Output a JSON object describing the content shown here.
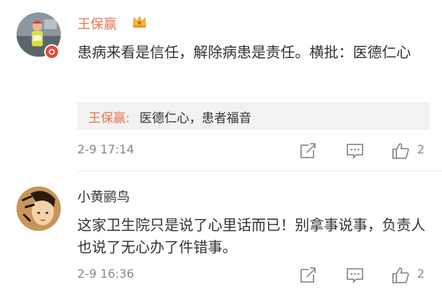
{
  "comments": [
    {
      "username": "王保赢",
      "text": "患病来看是信任，解除病患是责任。横批：医德仁心",
      "reply": {
        "username": "王保赢:",
        "text": "医德仁心，患者福音"
      },
      "time": "2-9 17:14",
      "likes": "2"
    },
    {
      "username": "小黄鹂鸟",
      "text": "这家卫生院只是说了心里话而已！别拿事说事，负责人也说了无心办了件错事。",
      "time": "2-9 16:36",
      "likes": "2"
    }
  ],
  "colors": {
    "username_highlight": "#eb7350",
    "text": "#333333",
    "meta": "#8a8a8a",
    "reply_bg": "#f2f2f2",
    "badge": "#e8483b"
  },
  "icons": [
    "crown-icon",
    "verified-badge-icon",
    "share-icon",
    "comment-icon",
    "like-icon"
  ]
}
